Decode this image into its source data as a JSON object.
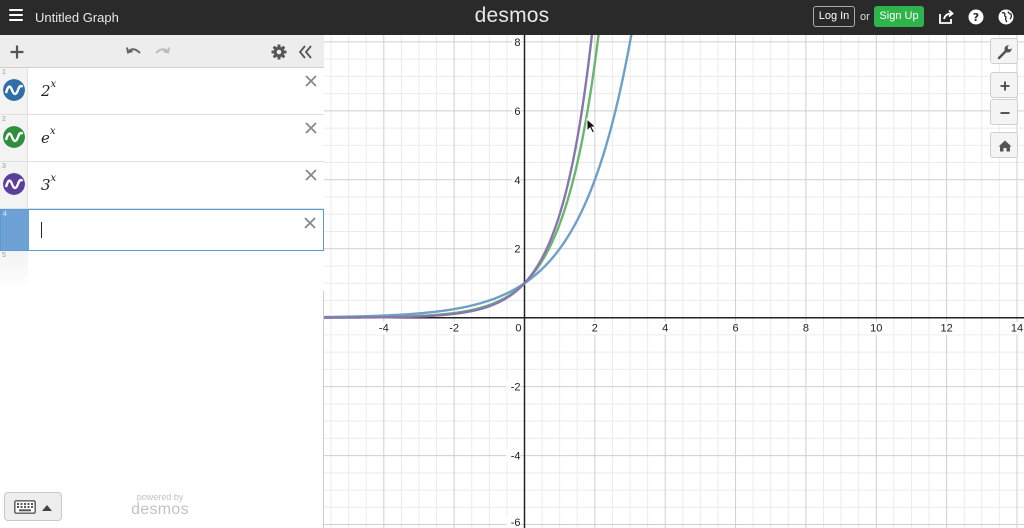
{
  "header": {
    "title": "Untitled Graph",
    "brand": "desmos",
    "login_label": "Log In",
    "or_label": "or",
    "signup_label": "Sign Up"
  },
  "expressions": [
    {
      "num": "1",
      "base": "2",
      "exp": "x",
      "color": "#2f6fa8"
    },
    {
      "num": "2",
      "base": "e",
      "exp": "x",
      "color": "#2f8f3f"
    },
    {
      "num": "3",
      "base": "3",
      "exp": "x",
      "color": "#5b3f9a"
    },
    {
      "num": "4",
      "base": "",
      "exp": "",
      "color": ""
    },
    {
      "num": "5",
      "base": "",
      "exp": "",
      "color": ""
    }
  ],
  "footer": {
    "powered_small": "powered by",
    "powered_big": "desmos"
  },
  "chart_data": {
    "type": "line",
    "xlim": [
      -5.7,
      14.2
    ],
    "ylim": [
      -6.1,
      8.2
    ],
    "x_ticks": [
      -4,
      -2,
      0,
      2,
      4,
      6,
      8,
      10,
      12,
      14
    ],
    "y_ticks": [
      -6,
      -4,
      -2,
      2,
      4,
      6,
      8
    ],
    "x_tick_labels": [
      "-4",
      "-2",
      "0",
      "2",
      "4",
      "6",
      "8",
      "10",
      "12",
      "14"
    ],
    "y_tick_labels": [
      "-6",
      "-4",
      "-2",
      "2",
      "4",
      "6",
      "8"
    ],
    "grid": true,
    "series": [
      {
        "base": 2,
        "color": "#6fa0c8"
      },
      {
        "base": 2.718281828,
        "color": "#6cb56e"
      },
      {
        "base": 3,
        "color": "#8876b0"
      }
    ]
  },
  "icons": {
    "menu": "hamburger-icon",
    "add": "plus-icon",
    "undo": "undo-icon",
    "redo": "redo-icon",
    "settings": "gear-icon",
    "collapse": "double-chevron-left-icon",
    "share": "share-icon",
    "help": "help-icon",
    "language": "globe-icon",
    "wrench": "wrench-icon",
    "zoom_in": "plus-icon",
    "zoom_out": "minus-icon",
    "home": "home-icon",
    "keyboard": "keyboard-icon"
  }
}
